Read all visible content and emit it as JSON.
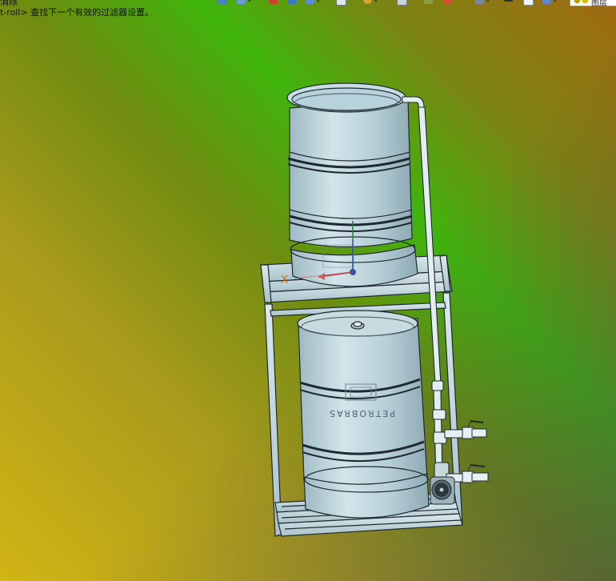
{
  "command_line": {
    "line1": "消除",
    "line2": "t-roll> 查找下一个有效的过滤器设置。"
  },
  "toolbar": {
    "layer_label": "图层"
  },
  "model": {
    "lower_drum_label": "PETROBRAS",
    "axis_label": "X"
  },
  "colors": {
    "drum_fill": "#bcd4dc",
    "frame_fill": "#c5dae0",
    "outline": "#1e2a30"
  }
}
